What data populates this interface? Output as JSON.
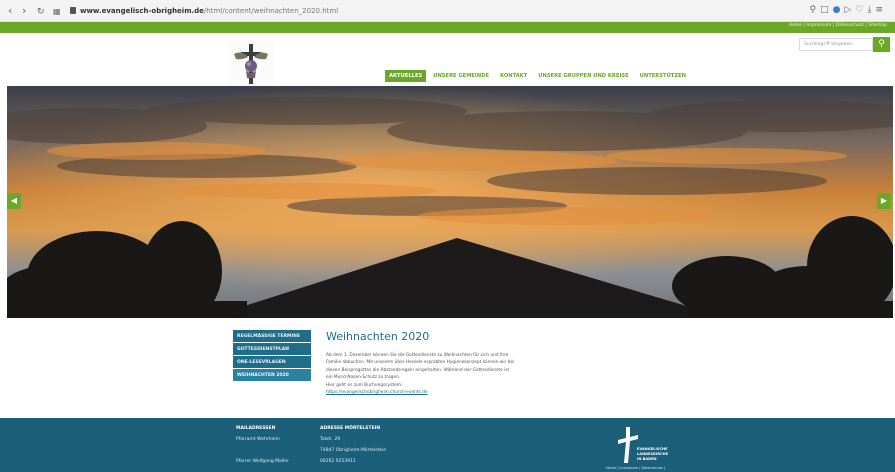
{
  "browser": {
    "url_host": "www.evangelisch-obrigheim.de",
    "url_path": "/html/content/weihnachten_2020.html"
  },
  "topbar": {
    "links": "Home | Impressum | Datenschutz | Sitemap"
  },
  "header": {
    "search_placeholder": "Suchbegriff eingeben",
    "nav": [
      {
        "label": "AKTUELLES",
        "active": true
      },
      {
        "label": "UNSERE GEMEINDE",
        "active": false
      },
      {
        "label": "KONTAKT",
        "active": false
      },
      {
        "label": "UNSERE GRUPPEN UND KREISE",
        "active": false
      },
      {
        "label": "UNTERSTÜTZEN",
        "active": false
      }
    ]
  },
  "sidebar": {
    "items": [
      {
        "label": "REGELMÄSSIGE TERMINE",
        "active": false
      },
      {
        "label": "GOTTESDIENSTPLAN",
        "active": false
      },
      {
        "label": "ONE-LESEVRLAGEN",
        "active": false
      },
      {
        "label": "WEIHNACHTEN 2020",
        "active": true
      }
    ]
  },
  "article": {
    "title": "Weihnachten 2020",
    "lines": [
      "Ab dem 1. Dezember können Sie die Gottesdienste zu Weihnachten für sich und Ihre",
      "Familie abbuchen. Mit unserem über Hessele erprobten Hygienekonzept können wir bei",
      "diesen Beispregottes die Abstandsregeln eingehalten. Während der Gottesdienste ist",
      "ein Mund-Nasen-Schutz zu tragen.",
      "Hier geht es zum Buchungssystem:"
    ],
    "link": "https://evangelischobrigheim.church-events.de"
  },
  "footer": {
    "col1": [
      "MAILADRESSEN",
      "Pfarramt Wehrheim",
      "",
      "Pfarrer Wolfgang Maller"
    ],
    "col2": [
      "ADRESSE MÖRTELSTEIN",
      "Talstr. 29",
      "74847 Obrigheim-Mörtelstein",
      "06262 9253911"
    ],
    "ekiba_lines": [
      "EVANGELISCHE",
      "LANDESKIRCHE",
      "IN BADEN"
    ],
    "ekiba_links": "Home | Impressum | Datenschutz |"
  },
  "colors": {
    "brand_green": "#6aa828",
    "brand_blue": "#1e6d8a",
    "footer_blue": "#1b5f7b"
  }
}
